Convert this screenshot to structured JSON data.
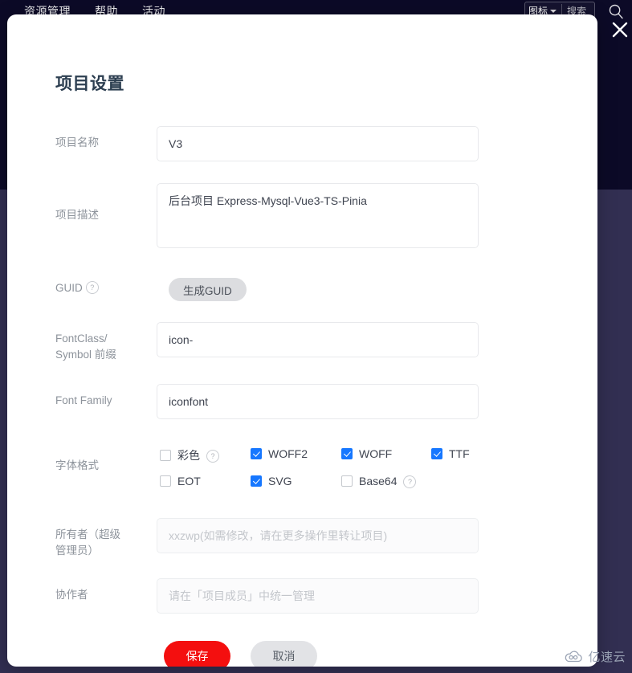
{
  "background": {
    "nav_items": [
      "资源管理",
      "帮助",
      "活动"
    ],
    "search": {
      "type_label": "图标",
      "placeholder": "搜索"
    },
    "top_color": "#0c0a27",
    "body_color": "#322f52"
  },
  "modal": {
    "title": "项目设置",
    "close_label": "×",
    "rows": {
      "project_name": {
        "label": "项目名称",
        "value": "V3"
      },
      "project_desc": {
        "label": "项目描述",
        "value": "后台项目 Express-Mysql-Vue3-TS-Pinia"
      },
      "guid": {
        "label": "GUID",
        "help": "?",
        "button_label": "生成GUID"
      },
      "prefix": {
        "label_line1": "FontClass/",
        "label_line2": "Symbol 前缀",
        "value": "icon-"
      },
      "font_family": {
        "label": "Font Family",
        "value": "iconfont"
      },
      "font_format": {
        "label": "字体格式",
        "options": [
          {
            "label": "彩色",
            "checked": false,
            "help": "?"
          },
          {
            "label": "WOFF2",
            "checked": true,
            "help": ""
          },
          {
            "label": "WOFF",
            "checked": true,
            "help": ""
          },
          {
            "label": "TTF",
            "checked": true,
            "help": ""
          },
          {
            "label": "EOT",
            "checked": false,
            "help": ""
          },
          {
            "label": "SVG",
            "checked": true,
            "help": ""
          },
          {
            "label": "Base64",
            "checked": false,
            "help": "?"
          }
        ]
      },
      "owner": {
        "label_line1": "所有者（超级",
        "label_line2": "管理员）",
        "placeholder": "xxzwp(如需修改，请在更多操作里转让项目)"
      },
      "collaborator": {
        "label": "协作者",
        "placeholder": "请在「项目成员」中统一管理"
      }
    },
    "actions": {
      "save_label": "保存",
      "cancel_label": "取消",
      "save_color": "#f40f0f",
      "cancel_color": "#e2e3e6"
    }
  },
  "watermark": {
    "text": "亿速云"
  }
}
